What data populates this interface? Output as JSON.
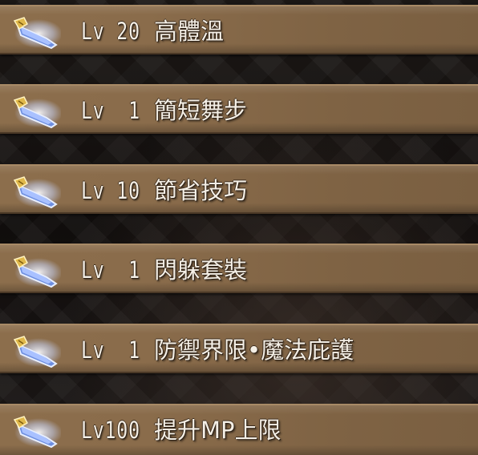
{
  "skills": [
    {
      "level_label": "Lv 20",
      "name": "高體溫",
      "icon": "skill-crystal-icon"
    },
    {
      "level_label": "Lv  1",
      "name": "簡短舞步",
      "icon": "skill-crystal-icon"
    },
    {
      "level_label": "Lv 10",
      "name": "節省技巧",
      "icon": "skill-crystal-icon"
    },
    {
      "level_label": "Lv  1",
      "name": "閃躲套裝",
      "icon": "skill-crystal-icon"
    },
    {
      "level_label": "Lv  1",
      "name": "防禦界限•魔法庇護",
      "icon": "skill-crystal-icon"
    },
    {
      "level_label": "Lv100",
      "name": "提升MP上限",
      "icon": "skill-crystal-icon"
    }
  ],
  "colors": {
    "row_base": "#8a6c4b",
    "row_highlight": "#a88a66",
    "text": "#f4efe6",
    "crystal": "#8fb4ff",
    "crystal_glow": "#dbe6ff",
    "gold": "#d9b13a"
  }
}
